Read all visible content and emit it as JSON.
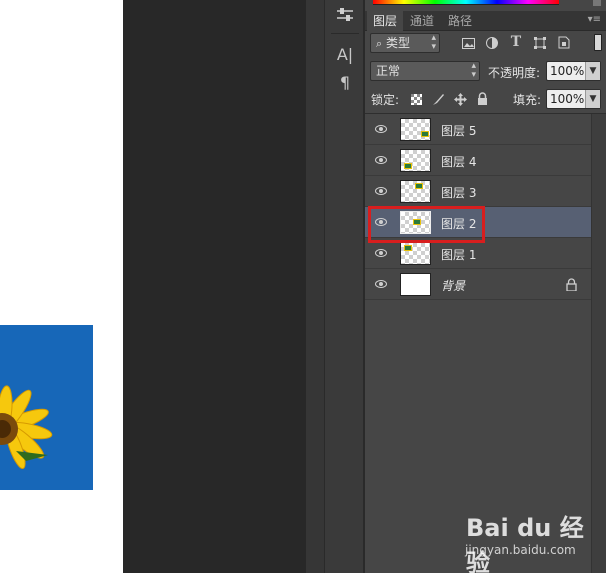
{
  "layers_panel": {
    "tabs": [
      {
        "label": "图层",
        "active": true
      },
      {
        "label": "通道",
        "active": false
      },
      {
        "label": "路径",
        "active": false
      }
    ],
    "filter_kind": "类型",
    "blend_mode": "正常",
    "opacity_label": "不透明度:",
    "opacity_value": "100%",
    "lock_label": "锁定:",
    "fill_label": "填充:",
    "fill_value": "100%",
    "layers": [
      {
        "name": "图层 5",
        "visible": true,
        "selected": false,
        "locked": false
      },
      {
        "name": "图层 4",
        "visible": true,
        "selected": false,
        "locked": false
      },
      {
        "name": "图层 3",
        "visible": true,
        "selected": false,
        "locked": false
      },
      {
        "name": "图层 2",
        "visible": true,
        "selected": true,
        "locked": false
      },
      {
        "name": "图层 1",
        "visible": true,
        "selected": false,
        "locked": false
      },
      {
        "name": "背景",
        "visible": true,
        "selected": false,
        "locked": true
      }
    ]
  },
  "tool_strip": {
    "icons": [
      "adjust-sliders-icon",
      "character-icon",
      "paragraph-icon"
    ],
    "character_glyph": "A|",
    "paragraph_glyph": "¶"
  },
  "watermark": {
    "logo": "Bai du 经验",
    "url": "jingyan.baidu.com"
  },
  "colors": {
    "panel_bg": "#464646",
    "selected_row": "#576073",
    "highlight": "#d81e1e",
    "canvas_blue": "#1767b8"
  }
}
